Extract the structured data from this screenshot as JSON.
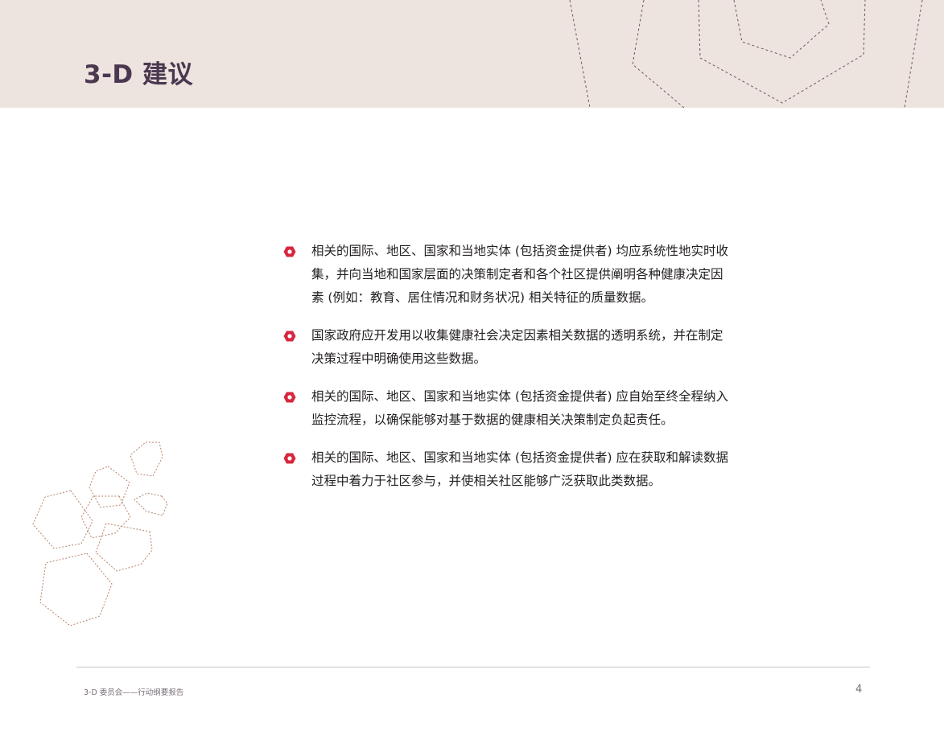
{
  "header": {
    "title": "3-D 建议"
  },
  "recommendations": [
    "相关的国际、地区、国家和当地实体 (包括资金提供者) 均应系统性地实时收集，并向当地和国家层面的决策制定者和各个社区提供阐明各种健康决定因素 (例如：教育、居住情况和财务状况) 相关特征的质量数据。",
    "国家政府应开发用以收集健康社会决定因素相关数据的透明系统，并在制定决策过程中明确使用这些数据。",
    "相关的国际、地区、国家和当地实体 (包括资金提供者) 应自始至终全程纳入监控流程，以确保能够对基于数据的健康相关决策制定负起责任。",
    "相关的国际、地区、国家和当地实体 (包括资金提供者) 应在获取和解读数据过程中着力于社区参与，并使相关社区能够广泛获取此类数据。"
  ],
  "footer": {
    "label": "3-D 委员会——行动纲要报告",
    "page_number": "4"
  },
  "colors": {
    "header_band": "#ede3df",
    "title": "#4a3850",
    "bullet": "#d7263d",
    "hex_outline": "#b8826a"
  },
  "icons": {
    "bullet": "red-hexagon-ring-icon"
  }
}
